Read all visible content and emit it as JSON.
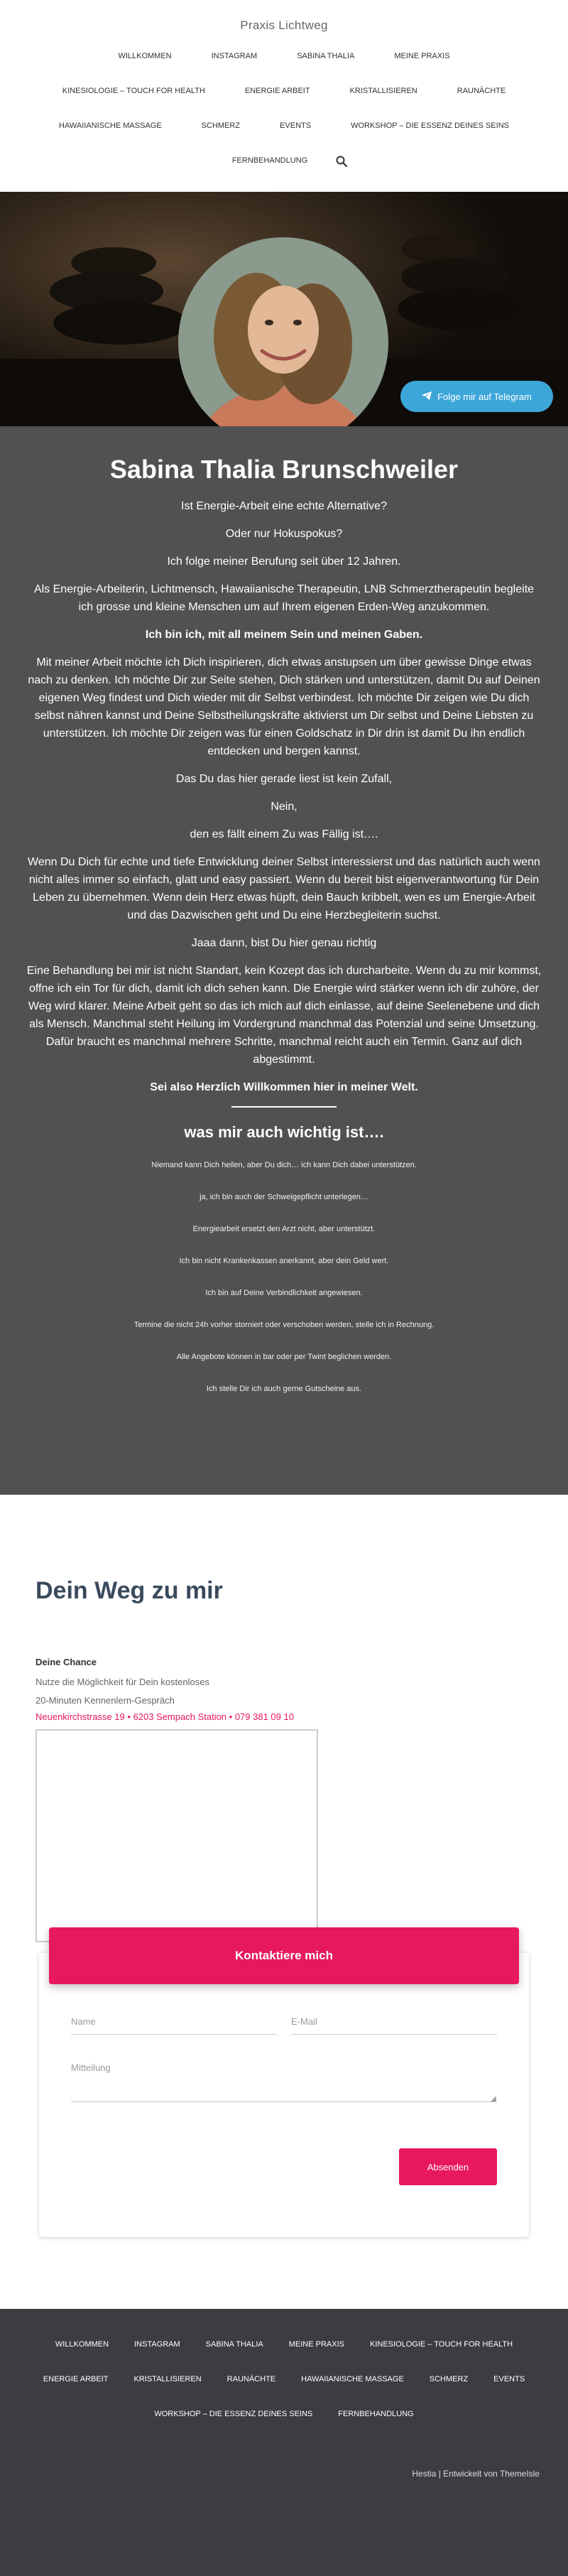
{
  "site": {
    "title": "Praxis Lichtweg"
  },
  "nav": {
    "items": [
      "Willkommen",
      "Instagram",
      "Sabina Thalia",
      "Meine Praxis",
      "Kinesiologie – Touch for Health",
      "Energie Arbeit",
      "Kristallisieren",
      "Raunächte",
      "Hawaiianische Massage",
      "Schmerz",
      "Events",
      "Workshop – Die Essenz deines Seins",
      "Fernbehandlung"
    ],
    "search_icon": "search-icon"
  },
  "hero": {
    "telegram_label": "Folge mir auf Telegram",
    "telegram_icon": "paper-plane-icon"
  },
  "content": {
    "title": "Sabina Thalia Brunschweiler",
    "paragraphs": [
      "Ist Energie-Arbeit eine echte Alternative?",
      "Oder nur Hokuspokus?",
      "Ich folge meiner Berufung seit über 12 Jahren.",
      "Als Energie-Arbeiterin, Lichtmensch, Hawaiianische Therapeutin, LNB Schmerztherapeutin begleite ich grosse und kleine Menschen um auf Ihrem eigenen Erden-Weg anzukommen.",
      "Ich bin ich, mit all meinem Sein und meinen Gaben.",
      "Mit meiner Arbeit möchte ich Dich inspirieren, dich etwas anstupsen um über gewisse Dinge etwas nach zu denken. Ich möchte Dir zur Seite stehen, Dich stärken und unterstützen, damit Du auf Deinen eigenen Weg findest und Dich wieder mit dir Selbst verbindest. Ich möchte Dir zeigen wie Du dich selbst nähren kannst und Deine Selbstheilungskräfte aktivierst um Dir selbst und Deine Liebsten zu unterstützen. Ich möchte Dir zeigen was für einen Goldschatz in Dir drin ist damit Du ihn endlich entdecken und bergen kannst.",
      "Das Du das hier gerade liest ist kein Zufall,",
      "Nein,",
      "den es fällt einem Zu was Fällig ist….",
      "Wenn Du Dich für echte und tiefe Entwicklung deiner Selbst interessierst und das natürlich auch wenn nicht alles immer so einfach, glatt und easy passiert. Wenn du bereit bist eigenverantwortung für Dein Leben zu übernehmen. Wenn dein Herz etwas hüpft, dein Bauch kribbelt, wen es um Energie-Arbeit und das Dazwischen geht und Du eine Herzbegleiterin suchst.",
      "Jaaa dann, bist Du hier genau richtig",
      "Eine Behandlung bei mir ist nicht Standart, kein Kozept das ich durcharbeite. Wenn du zu mir kommst, offne ich ein Tor für dich, damit ich dich sehen kann. Die Energie wird stärker wenn ich dir zuhöre, der Weg wird klarer. Meine Arbeit geht so das ich mich auf dich einlasse, auf deine Seelenebene und dich als Mensch. Manchmal steht Heilung im Vordergrund manchmal das Potenzial und seine Umsetzung. Dafür braucht es manchmal mehrere Schritte, manchmal reicht auch ein Termin. Ganz auf dich abgestimmt.",
      "Sei also Herzlich Willkommen hier in meiner Welt."
    ],
    "subtitle": "was mir auch wichtig ist….",
    "notes": [
      "Niemand kann Dich heilen, aber Du dich… ich kann Dich dabei unterstützen.",
      "ja, ich bin auch der Schweigepflicht unterlegen…",
      "Energiearbeit ersetzt den Arzt nicht, aber unterstützt.",
      "Ich bin nicht Krankenkassen anerkannt, aber dein Geld wert.",
      "Ich bin auf Deine Verbindlichkeit angewiesen.",
      "Termine die nicht 24h vorher storniert oder verschoben werden, stelle ich in Rechnung.",
      "Alle Angebote können in bar oder per Twint beglichen werden.",
      "Ich stelle Dir ich auch gerne Gutscheine aus."
    ]
  },
  "contact": {
    "heading": "Dein Weg zu mir",
    "chance": "Deine Chance",
    "line1": "Nutze die Möglichkeit für Dein kostenloses",
    "line2": "20-Minuten Kennenlern-Gespräch",
    "address": "Neuenkirchstrasse 19  •  6203 Sempach Station  •  079 381 09 10",
    "form_title": "Kontaktiere mich",
    "name_placeholder": "Name",
    "email_placeholder": "E-Mail",
    "message_placeholder": "Mitteilung",
    "send_label": "Absenden"
  },
  "footer": {
    "items": [
      "Willkommen",
      "Instagram",
      "Sabina Thalia",
      "Meine Praxis",
      "Kinesiologie – Touch for Health",
      "Energie Arbeit",
      "Kristallisieren",
      "Raunächte",
      "Hawaiianische Massage",
      "Schmerz",
      "Events",
      "Workshop – Die Essenz deines Seins",
      "Fernbehandlung"
    ],
    "copyright": "Hestia | Entwickelt von ThemeIsle"
  }
}
